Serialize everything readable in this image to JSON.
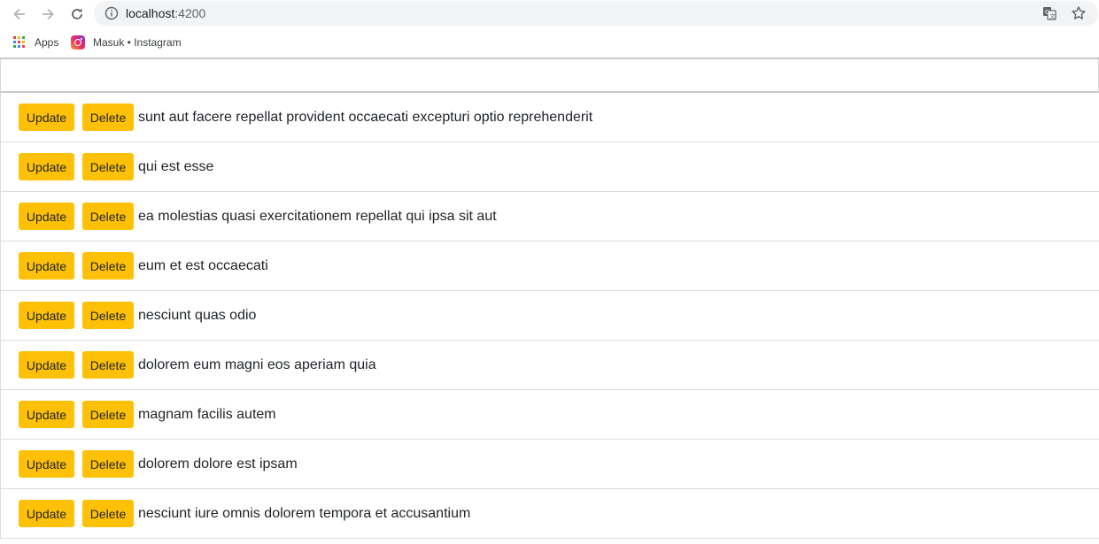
{
  "browser": {
    "url_host": "localhost",
    "url_port": ":4200",
    "bookmarks": [
      {
        "label": "Apps",
        "icon": "apps-grid-icon"
      },
      {
        "label": "Masuk • Instagram",
        "icon": "instagram-icon"
      }
    ]
  },
  "page": {
    "input_value": "",
    "update_label": "Update",
    "delete_label": "Delete",
    "button_color": "#ffc107",
    "items": [
      {
        "title": "sunt aut facere repellat provident occaecati excepturi optio reprehenderit"
      },
      {
        "title": "qui est esse"
      },
      {
        "title": "ea molestias quasi exercitationem repellat qui ipsa sit aut"
      },
      {
        "title": "eum et est occaecati"
      },
      {
        "title": "nesciunt quas odio"
      },
      {
        "title": "dolorem eum magni eos aperiam quia"
      },
      {
        "title": "magnam facilis autem"
      },
      {
        "title": "dolorem dolore est ipsam"
      },
      {
        "title": "nesciunt iure omnis dolorem tempora et accusantium"
      }
    ]
  }
}
